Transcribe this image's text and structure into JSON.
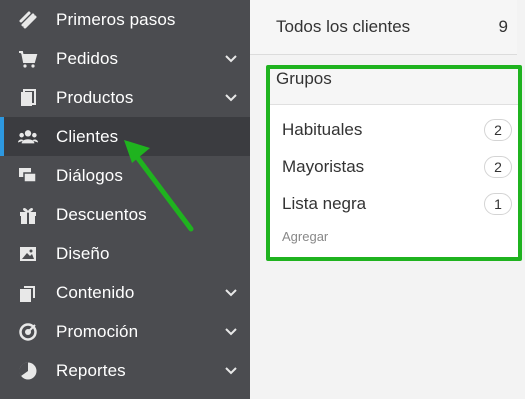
{
  "sidebar": {
    "items": [
      {
        "label": "Primeros pasos",
        "icon": "getting-started-icon",
        "has_submenu": false
      },
      {
        "label": "Pedidos",
        "icon": "cart-icon",
        "has_submenu": true
      },
      {
        "label": "Productos",
        "icon": "products-icon",
        "has_submenu": true
      },
      {
        "label": "Clientes",
        "icon": "users-icon",
        "has_submenu": false,
        "active": true
      },
      {
        "label": "Diálogos",
        "icon": "chat-icon",
        "has_submenu": false
      },
      {
        "label": "Descuentos",
        "icon": "gift-icon",
        "has_submenu": false
      },
      {
        "label": "Diseño",
        "icon": "image-icon",
        "has_submenu": false
      },
      {
        "label": "Contenido",
        "icon": "pages-icon",
        "has_submenu": true
      },
      {
        "label": "Promoción",
        "icon": "target-icon",
        "has_submenu": true
      },
      {
        "label": "Reportes",
        "icon": "pie-chart-icon",
        "has_submenu": true
      }
    ]
  },
  "main": {
    "all_clients": {
      "label": "Todos los clientes",
      "count": "9"
    },
    "groups": {
      "title": "Grupos",
      "items": [
        {
          "name": "Habituales",
          "count": "2"
        },
        {
          "name": "Mayoristas",
          "count": "2"
        },
        {
          "name": "Lista negra",
          "count": "1"
        }
      ],
      "add_label": "Agregar"
    }
  },
  "colors": {
    "sidebar_bg": "#4b4c50",
    "active_bg": "#3b3c40",
    "active_accent": "#2d98e0",
    "highlight": "#1fb31f"
  }
}
